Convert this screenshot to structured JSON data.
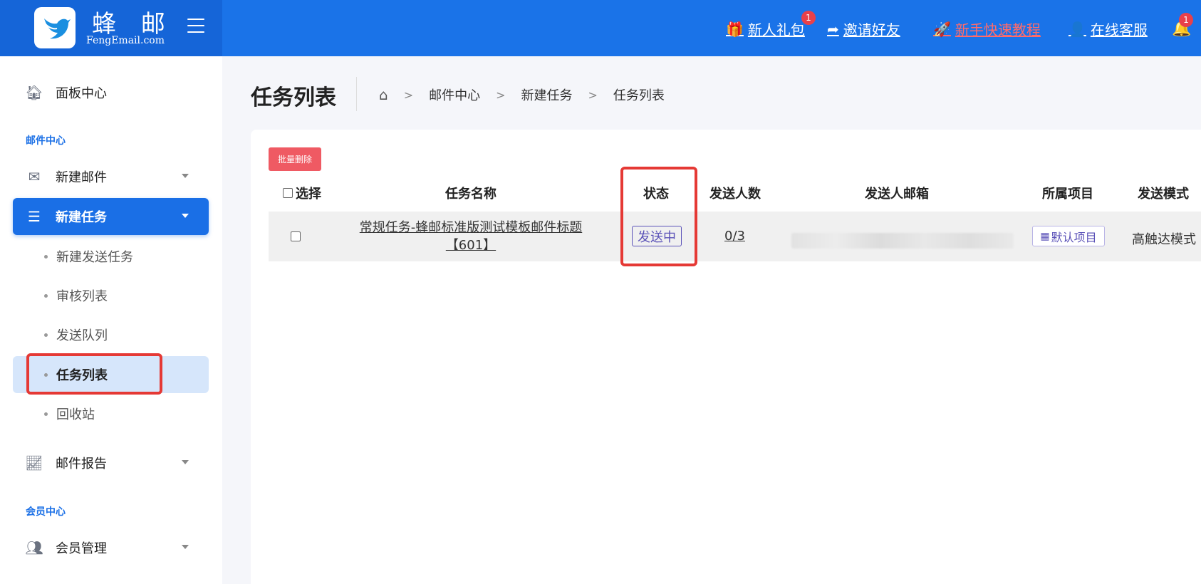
{
  "header": {
    "logo_cn": "蜂 邮",
    "logo_en": "FengEmail.com",
    "links": [
      {
        "label": "新人礼包",
        "icon": "gift-icon",
        "badge": "1"
      },
      {
        "label": "邀请好友",
        "icon": "share-icon"
      },
      {
        "label": "新手快速教程",
        "icon": "rocket-icon"
      },
      {
        "label": "在线客服",
        "icon": "user-icon"
      }
    ],
    "bell_badge": "1"
  },
  "sidebar": {
    "dashboard": "面板中心",
    "section_mail": "邮件中心",
    "new_mail": "新建邮件",
    "new_task": "新建任务",
    "sub_items": [
      "新建发送任务",
      "审核列表",
      "发送队列",
      "任务列表",
      "回收站"
    ],
    "mail_report": "邮件报告",
    "section_member": "会员中心",
    "member_manage": "会员管理"
  },
  "page": {
    "title": "任务列表",
    "breadcrumb": [
      "邮件中心",
      "新建任务",
      "任务列表"
    ]
  },
  "toolbar": {
    "batch_delete": "批量删除"
  },
  "table": {
    "columns": [
      "选择",
      "任务名称",
      "状态",
      "发送人数",
      "发送人邮箱",
      "所属项目",
      "发送模式"
    ],
    "rows": [
      {
        "task_name": "常规任务-蜂邮标准版测试模板邮件标题【601】",
        "status": "发送中",
        "count": "0/3",
        "project": "默认项目",
        "mode": "高触达模式"
      }
    ]
  },
  "colors": {
    "primary": "#1a73e8",
    "danger": "#ef5a63",
    "status": "#5b52b8",
    "highlight": "#e53935"
  }
}
